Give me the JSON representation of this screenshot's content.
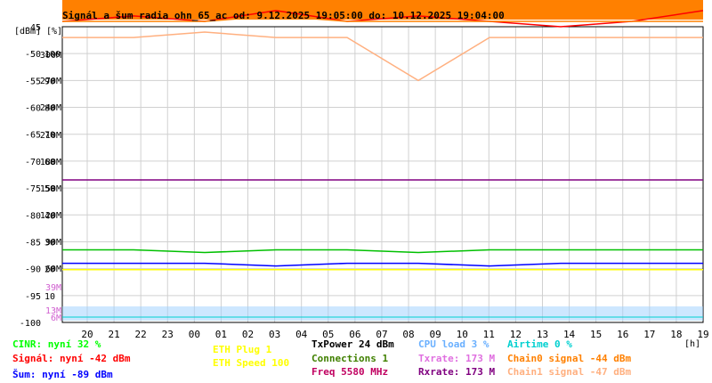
{
  "chart_data": {
    "type": "line",
    "title": "Signál a šum radia ohn_65_ac od: 9.12.2025 19:05:00 do: 10.12.2025 19:04:00",
    "unit_labels": [
      "[dBm]",
      "[%]"
    ],
    "x_unit": "[h]",
    "x_ticks": [
      "20",
      "21",
      "22",
      "23",
      "00",
      "01",
      "02",
      "03",
      "04",
      "05",
      "06",
      "07",
      "08",
      "09",
      "10",
      "11",
      "12",
      "13",
      "14",
      "15",
      "16",
      "17",
      "18",
      "19"
    ],
    "y_ticks_dbm": [
      "-45",
      "-50",
      "-55",
      "-60",
      "-65",
      "-70",
      "-75",
      "-80",
      "-85",
      "-90",
      "-95",
      "-100"
    ],
    "y_ticks_pct": [
      "100",
      "90",
      "80",
      "70",
      "60",
      "50",
      "40",
      "30",
      "20",
      "10"
    ],
    "y_ticks_rate": [
      "300M",
      "270M",
      "240M",
      "210M",
      "180M",
      "150M",
      "120M",
      "90M",
      "60M",
      "39M",
      "13M",
      "6M"
    ],
    "ylim_dbm": [
      -100,
      -45
    ],
    "series": [
      {
        "name": "Signál",
        "color": "#ff0000",
        "values": [
          -44,
          -43,
          -44,
          -42,
          -44,
          -43,
          -44,
          -45,
          -44,
          -42
        ]
      },
      {
        "name": "Chain0 signal",
        "color": "#ff8000",
        "values": [
          -44,
          -44,
          -44,
          -43,
          -44,
          -44,
          -44,
          -44,
          -44,
          -44
        ]
      },
      {
        "name": "Chain1 signal",
        "color": "#ffb080",
        "values": [
          -47,
          -47,
          -46,
          -47,
          -47,
          -55,
          -47,
          -47,
          -47,
          -47
        ]
      },
      {
        "name": "Rxrate",
        "color": "#800080",
        "values": [
          -73.5,
          -73.5,
          -73.5,
          -73.5,
          -73.5,
          -73.5,
          -73.5,
          -73.5,
          -73.5,
          -73.5
        ]
      },
      {
        "name": "CINR",
        "color": "#00c000",
        "values": [
          -86.5,
          -86.5,
          -87,
          -86.5,
          -86.5,
          -87,
          -86.5,
          -86.5,
          -86.5,
          -86.5
        ]
      },
      {
        "name": "Šum",
        "color": "#0000ff",
        "values": [
          -89,
          -89,
          -89,
          -89.5,
          -89,
          -89,
          -89.5,
          -89,
          -89,
          -89
        ]
      },
      {
        "name": "ETH Speed",
        "color": "#ffff00",
        "values": [
          -90.2,
          -90.2,
          -90.2,
          -90.2,
          -90.2,
          -90.2,
          -90.2,
          -90.2,
          -90.2,
          -90.2
        ]
      }
    ],
    "legend": [
      {
        "text": "CINR: nyní 32 %",
        "color": "#00ff00"
      },
      {
        "text": "Signál: nyní -42 dBm",
        "color": "#ff0000"
      },
      {
        "text": "Šum: nyní -89 dBm",
        "color": "#0000ff"
      },
      {
        "text": "ETH Plug 1",
        "color": "#ffff00"
      },
      {
        "text": "ETH Speed 100",
        "color": "#ffff00"
      },
      {
        "text": "TxPower 24 dBm",
        "color": "#000000"
      },
      {
        "text": "Connections 1",
        "color": "#408000"
      },
      {
        "text": "Freq 5580 MHz",
        "color": "#c00060"
      },
      {
        "text": "CPU load 3 %",
        "color": "#6ab0ff"
      },
      {
        "text": "Txrate: 173 M",
        "color": "#e070e0"
      },
      {
        "text": "Rxrate: 173 M",
        "color": "#800080"
      },
      {
        "text": "Airtime 0 %",
        "color": "#00d0d0"
      },
      {
        "text": "Chain0 signal -44 dBm",
        "color": "#ff8000"
      },
      {
        "text": "Chain1 signal -47 dBm",
        "color": "#ffb080"
      }
    ]
  }
}
